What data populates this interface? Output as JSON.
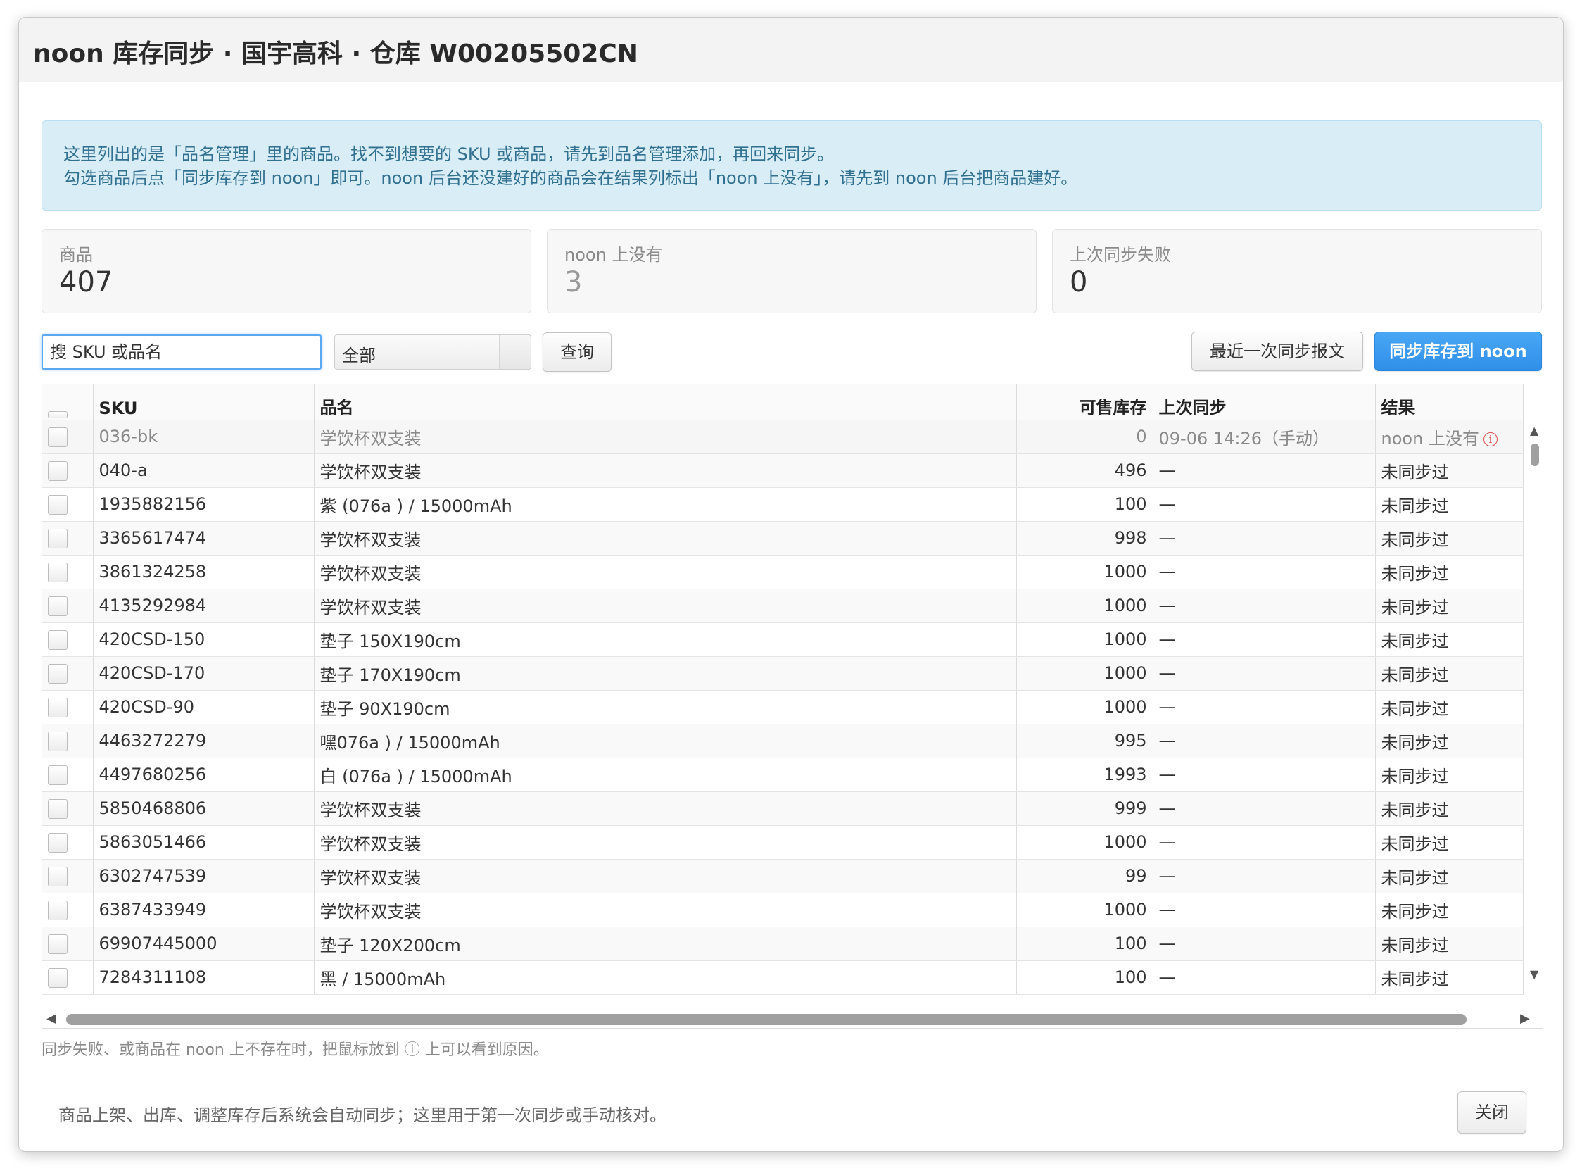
{
  "dialog": {
    "title": "noon 库存同步 · 国宇高科 · 仓库 W00205502CN",
    "alert_line1": "这里列出的是「品名管理」里的商品。找不到想要的 SKU 或商品，请先到品名管理添加，再回来同步。",
    "alert_line2": "勾选商品后点「同步库存到 noon」即可。noon 后台还没建好的商品会在结果列标出「noon 上没有」，请先到 noon 后台把商品建好。"
  },
  "stats": [
    {
      "label": "商品",
      "value": "407"
    },
    {
      "label": "noon 上没有",
      "value": "3"
    },
    {
      "label": "上次同步失败",
      "value": "0"
    }
  ],
  "toolbar": {
    "search_placeholder": "搜 SKU 或品名",
    "filter_value": "全部",
    "query_label": "查询",
    "last_report_label": "最近一次同步报文",
    "sync_label": "同步库存到 noon"
  },
  "table": {
    "columns": [
      "SKU",
      "品名",
      "可售库存",
      "上次同步",
      "结果"
    ],
    "rows": [
      {
        "sku": "036-bk",
        "name": "学饮杯双支装",
        "stock": "0",
        "last": "09-06 14:26（手动）",
        "result": "noon 上没有",
        "info": "i"
      },
      {
        "sku": "040-a",
        "name": "学饮杯双支装",
        "stock": "496",
        "last": "—",
        "result": "未同步过"
      },
      {
        "sku": "1935882156",
        "name": "紫 (076a ) / 15000mAh",
        "stock": "100",
        "last": "—",
        "result": "未同步过"
      },
      {
        "sku": "3365617474",
        "name": "学饮杯双支装",
        "stock": "998",
        "last": "—",
        "result": "未同步过"
      },
      {
        "sku": "3861324258",
        "name": "学饮杯双支装",
        "stock": "1000",
        "last": "—",
        "result": "未同步过"
      },
      {
        "sku": "4135292984",
        "name": "学饮杯双支装",
        "stock": "1000",
        "last": "—",
        "result": "未同步过"
      },
      {
        "sku": "420CSD-150",
        "name": "垫子 150X190cm",
        "stock": "1000",
        "last": "—",
        "result": "未同步过"
      },
      {
        "sku": "420CSD-170",
        "name": "垫子 170X190cm",
        "stock": "1000",
        "last": "—",
        "result": "未同步过"
      },
      {
        "sku": "420CSD-90",
        "name": "垫子 90X190cm",
        "stock": "1000",
        "last": "—",
        "result": "未同步过"
      },
      {
        "sku": "4463272279",
        "name": "嘿076a ) / 15000mAh",
        "stock": "995",
        "last": "—",
        "result": "未同步过"
      },
      {
        "sku": "4497680256",
        "name": "白 (076a ) / 15000mAh",
        "stock": "1993",
        "last": "—",
        "result": "未同步过"
      },
      {
        "sku": "5850468806",
        "name": "学饮杯双支装",
        "stock": "999",
        "last": "—",
        "result": "未同步过"
      },
      {
        "sku": "5863051466",
        "name": "学饮杯双支装",
        "stock": "1000",
        "last": "—",
        "result": "未同步过"
      },
      {
        "sku": "6302747539",
        "name": "学饮杯双支装",
        "stock": "99",
        "last": "—",
        "result": "未同步过"
      },
      {
        "sku": "6387433949",
        "name": "学饮杯双支装",
        "stock": "1000",
        "last": "—",
        "result": "未同步过"
      },
      {
        "sku": "69907445000",
        "name": "垫子 120X200cm",
        "stock": "100",
        "last": "—",
        "result": "未同步过"
      },
      {
        "sku": "7284311108",
        "name": "黑 / 15000mAh",
        "stock": "100",
        "last": "—",
        "result": "未同步过"
      }
    ]
  },
  "hint": "同步失败、或商品在 noon 上不存在时，把鼠标放到 ⓘ 上可以看到原因。",
  "footer": {
    "note": "商品上架、出库、调整库存后系统会自动同步；这里用于第一次同步或手动核对。",
    "close_label": "关闭"
  },
  "colors": {
    "primary": "#3a9af0",
    "alert_bg": "#d9edf7",
    "alert_text": "#31708f",
    "danger": "#d9534f"
  }
}
